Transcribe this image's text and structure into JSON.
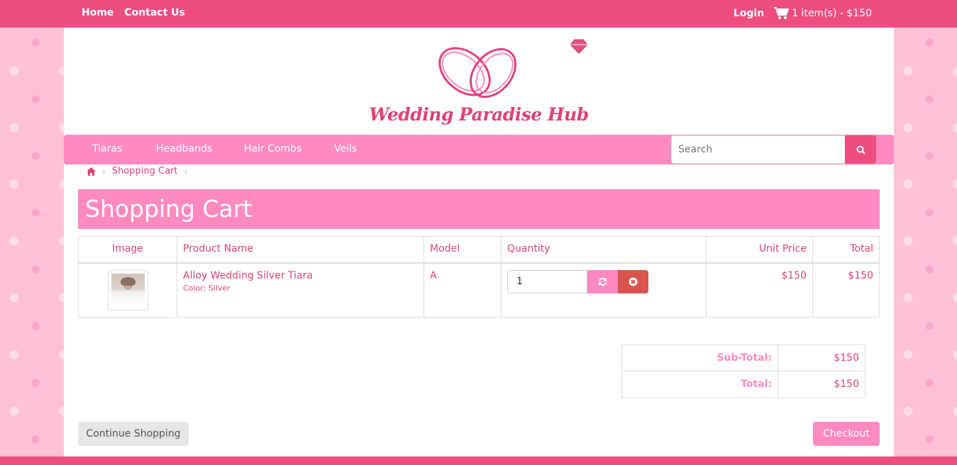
{
  "topbar": {
    "home": "Home",
    "contact": "Contact Us",
    "login": "Login",
    "cart_summary": "1 item(s) - $150"
  },
  "brand": {
    "name": "Wedding Paradise Hub",
    "colors": {
      "primary": "#ee4d80",
      "accent": "#ff8ac0",
      "danger": "#d9534f"
    }
  },
  "menu": {
    "items": [
      "Tiaras",
      "Headbands",
      "Hair Combs",
      "Veils"
    ],
    "search_placeholder": "Search"
  },
  "breadcrumb": {
    "current": "Shopping Cart"
  },
  "page": {
    "title": "Shopping Cart"
  },
  "cart_table": {
    "headers": [
      "Image",
      "Product Name",
      "Model",
      "Quantity",
      "Unit Price",
      "Total"
    ],
    "rows": [
      {
        "product_name": "Alloy Wedding Silver Tiara",
        "option": "Color: Silver",
        "model": "A",
        "quantity": "1",
        "unit_price": "$150",
        "total": "$150"
      }
    ]
  },
  "totals": {
    "subtotal_label": "Sub-Total:",
    "subtotal_value": "$150",
    "total_label": "Total:",
    "total_value": "$150"
  },
  "actions": {
    "continue": "Continue Shopping",
    "checkout": "Checkout"
  }
}
